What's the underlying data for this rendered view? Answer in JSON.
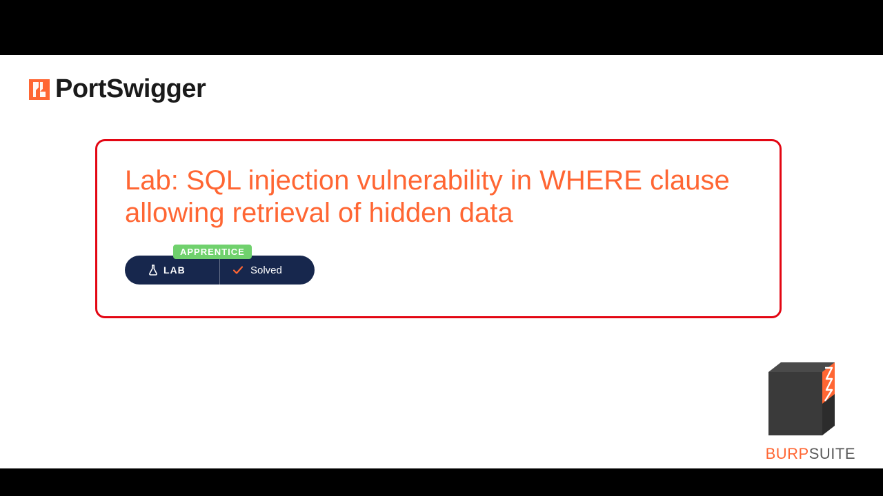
{
  "brand": {
    "name": "PortSwigger"
  },
  "lab": {
    "title": "Lab: SQL injection vulnerability in WHERE clause allowing retrieval of hidden data",
    "difficulty": "APPRENTICE",
    "badge_label": "LAB",
    "status": "Solved"
  },
  "footer": {
    "product_part1": "BURP",
    "product_part2": "SUITE"
  },
  "colors": {
    "accent": "#ff6633",
    "card_border": "#e30613",
    "pill_bg": "#17274d",
    "apprentice": "#70d16d"
  }
}
